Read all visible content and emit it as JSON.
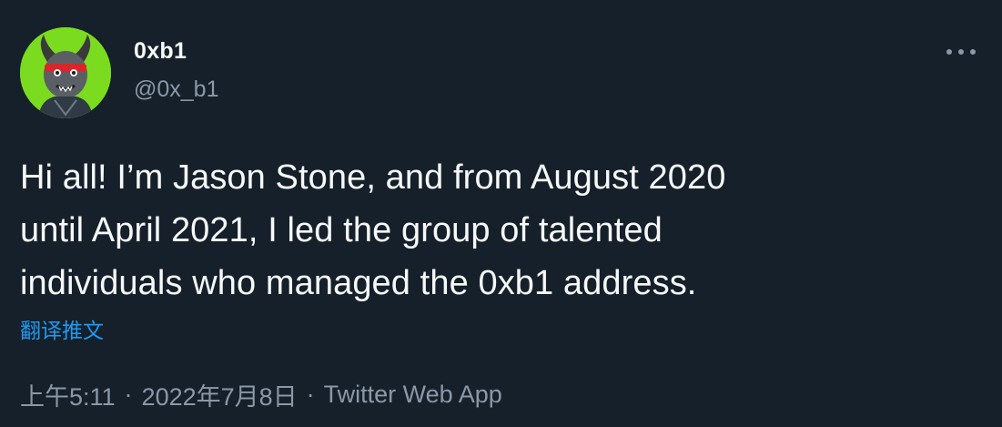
{
  "author": {
    "display_name": "0xb1",
    "handle": "@0x_b1"
  },
  "tweet": {
    "text": "Hi all! I’m Jason Stone, and from August 2020\nuntil April 2021, I led the group of talented\nindividuals who managed the 0xb1 address.",
    "translate_label": "翻译推文"
  },
  "meta": {
    "time": "上午5:11",
    "separator": "·",
    "date": "2022年7月8日",
    "source": "Twitter Web App"
  },
  "icons": {
    "more": "more-horizontal-icon",
    "avatar": "avatar-image"
  },
  "colors": {
    "background": "#15202b",
    "primary_text": "#f7f9f9",
    "secondary_text": "#8b98a5",
    "link": "#1d9bf0",
    "avatar_background": "#7bdc1f"
  }
}
